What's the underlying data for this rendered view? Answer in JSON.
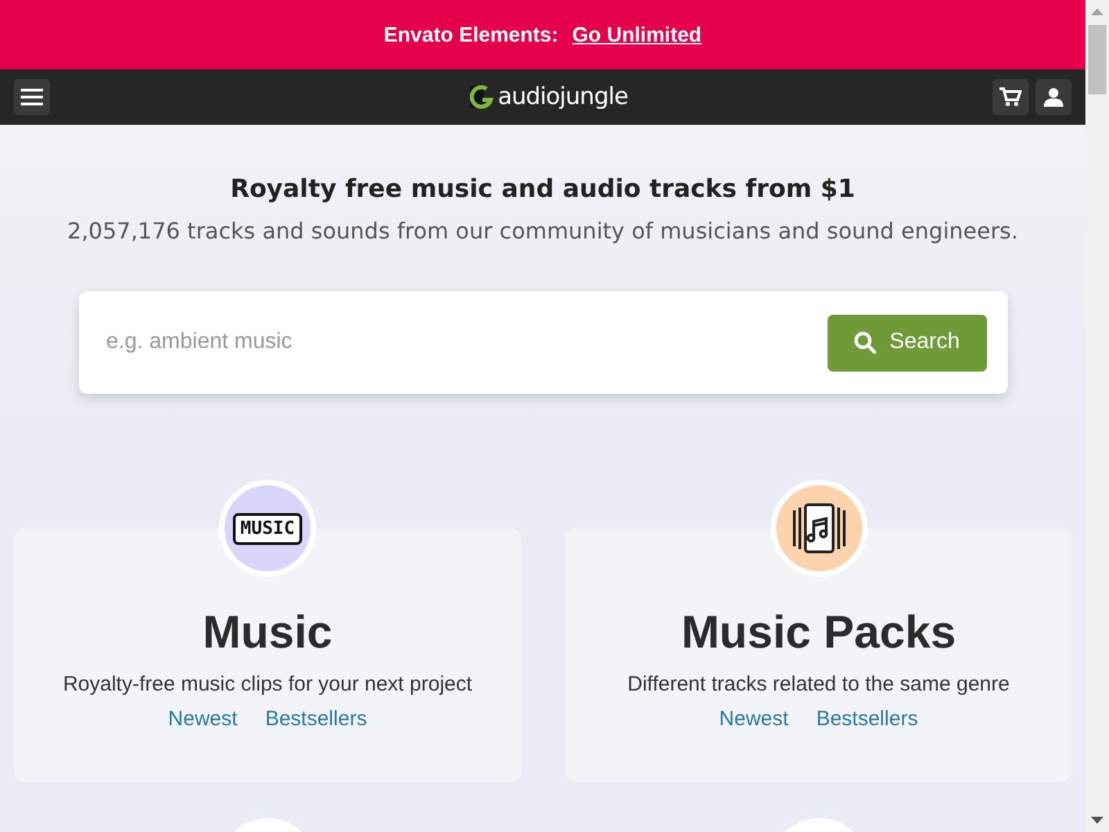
{
  "banner": {
    "label": "Envato Elements:",
    "link": "Go Unlimited"
  },
  "nav": {
    "logo": "audiojungle"
  },
  "hero": {
    "title": "Royalty free music and audio tracks from $1",
    "subtitle": "2,057,176 tracks and sounds from our community of musicians and sound engineers."
  },
  "search": {
    "placeholder": "e.g. ambient music",
    "button": "Search"
  },
  "categories": [
    {
      "kind": "music",
      "icon_text": "MUSIC",
      "title": "Music",
      "description": "Royalty-free music clips for your next project",
      "links": [
        "Newest",
        "Bestsellers"
      ]
    },
    {
      "kind": "packs",
      "title": "Music Packs",
      "description": "Different tracks related to the same genre",
      "links": [
        "Newest",
        "Bestsellers"
      ]
    }
  ]
}
